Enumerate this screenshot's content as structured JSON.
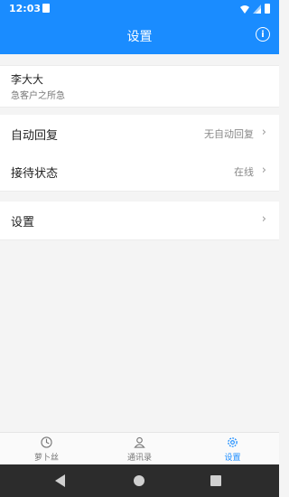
{
  "statusbar": {
    "time": "12:03"
  },
  "appbar": {
    "title": "设置",
    "info_icon": "i"
  },
  "profile": {
    "name": "李大大",
    "status": "急客户之所急"
  },
  "rows": [
    {
      "label": "自动回复",
      "value": "无自动回复",
      "chevron": "›"
    },
    {
      "label": "接待状态",
      "value": "在线",
      "chevron": "›"
    },
    {
      "label": "设置",
      "value": "",
      "chevron": "›"
    }
  ],
  "bottom_nav": {
    "tabs": [
      {
        "label": "萝卜丝",
        "icon": "clock-icon",
        "active": false
      },
      {
        "label": "通讯录",
        "icon": "contacts-icon",
        "active": false
      },
      {
        "label": "设置",
        "icon": "gear-icon",
        "active": true
      }
    ]
  },
  "colors": {
    "primary": "#1a8cff",
    "inactive": "#777777"
  }
}
